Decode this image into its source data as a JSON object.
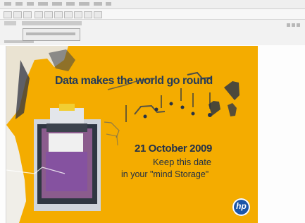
{
  "window": {
    "menus": [
      "",
      "",
      "",
      "",
      "",
      "",
      "",
      "",
      ""
    ],
    "toolbar_buttons": [
      "",
      "",
      "",
      "",
      "",
      "",
      "",
      "",
      "",
      ""
    ],
    "header_rows": [
      {
        "label": "",
        "value": ""
      },
      {
        "label": "",
        "value": ""
      }
    ],
    "link_bar": "",
    "status": "",
    "right_icons": [
      "",
      "",
      ""
    ]
  },
  "poster": {
    "title": "Data makes the world go round",
    "date": "21 October 2009",
    "subtitle_line1": "Keep this date",
    "subtitle_line2": "in your \"mind Storage\"",
    "logo": "hp",
    "colors": {
      "background": "#f4ac00",
      "accent": "#1c56a8"
    }
  }
}
